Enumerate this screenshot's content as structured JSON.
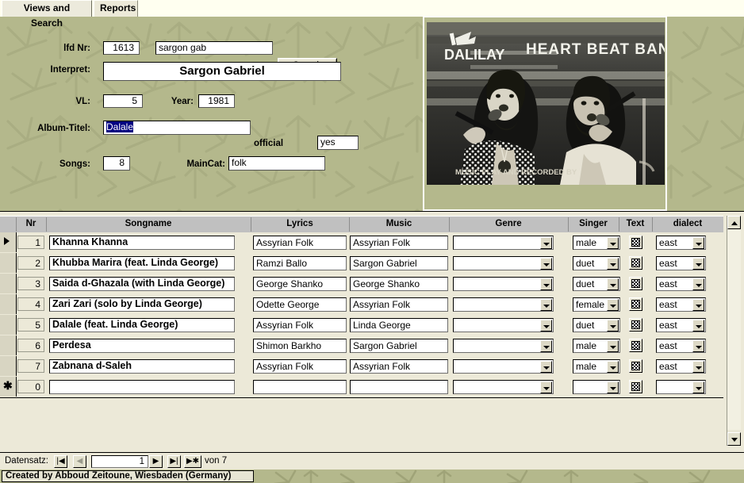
{
  "tabs": [
    {
      "label": "Views and Search",
      "active": true
    },
    {
      "label": "Reports",
      "active": false
    }
  ],
  "form": {
    "lfd_nr_label": "lfd Nr:",
    "lfd_nr_value": "1613",
    "search_term_value": "sargon gab",
    "search_button": "Search",
    "interpret_label": "Interpret:",
    "interpret_value": "Sargon Gabriel",
    "vl_label": "VL:",
    "vl_value": "5",
    "year_label": "Year:",
    "year_value": "1981",
    "album_label": "Album-Titel:",
    "album_value": "Dalale",
    "official_label": "official",
    "official_value": "yes",
    "songs_label": "Songs:",
    "songs_value": "8",
    "maincat_label": "MainCat:",
    "maincat_value": "folk"
  },
  "photo": {
    "label_left": "DALILAY",
    "label_right": "HEART BEAT BAND",
    "caption": "MUSIC PLAY AND RECORDED BY"
  },
  "table": {
    "columns": [
      "Nr",
      "Songname",
      "Lyrics",
      "Music",
      "Genre",
      "Singer",
      "Text",
      "dialect"
    ],
    "rows": [
      {
        "marker": "current",
        "nr": "1",
        "songname": "Khanna Khanna",
        "lyrics": "Assyrian Folk",
        "music": "Assyrian Folk",
        "genre": "",
        "singer": "male",
        "text": "",
        "dialect": "east"
      },
      {
        "marker": "",
        "nr": "2",
        "songname": "Khubba Marira  (feat. Linda George)",
        "lyrics": "Ramzi Ballo",
        "music": "Sargon Gabriel",
        "genre": "",
        "singer": "duet",
        "text": "",
        "dialect": "east"
      },
      {
        "marker": "",
        "nr": "3",
        "songname": "Saida d-Ghazala  (with Linda George)",
        "lyrics": "George Shanko",
        "music": "George Shanko",
        "genre": "",
        "singer": "duet",
        "text": "",
        "dialect": "east"
      },
      {
        "marker": "",
        "nr": "4",
        "songname": "Zari Zari (solo by Linda George)",
        "lyrics": "Odette George",
        "music": "Assyrian Folk",
        "genre": "",
        "singer": "female",
        "text": "",
        "dialect": "east"
      },
      {
        "marker": "",
        "nr": "5",
        "songname": "Dalale  (feat.  Linda George)",
        "lyrics": "Assyrian Folk",
        "music": "Linda George",
        "genre": "",
        "singer": "duet",
        "text": "",
        "dialect": "east"
      },
      {
        "marker": "",
        "nr": "6",
        "songname": "Perdesa",
        "lyrics": "Shimon Barkho",
        "music": "Sargon Gabriel",
        "genre": "",
        "singer": "male",
        "text": "",
        "dialect": "east"
      },
      {
        "marker": "",
        "nr": "7",
        "songname": "Zabnana d-Saleh",
        "lyrics": "Assyrian Folk",
        "music": "Assyrian Folk",
        "genre": "",
        "singer": "male",
        "text": "",
        "dialect": "east"
      },
      {
        "marker": "new",
        "nr": "0",
        "songname": "",
        "lyrics": "",
        "music": "",
        "genre": "",
        "singer": "",
        "text": "",
        "dialect": ""
      }
    ]
  },
  "nav": {
    "label": "Datensatz:",
    "first": "|◀",
    "prev": "◀",
    "current": "1",
    "next": "▶",
    "last": "▶|",
    "new": "▶✱",
    "of_label": "von",
    "total": "7"
  },
  "status": {
    "text": "Created by Abboud Zeitoune, Wiesbaden (Germany)"
  },
  "colors": {
    "form_background": "#b4b88c",
    "sheet_background": "#ece9d8",
    "header_gray": "#c0c0c0",
    "selection_blue": "#000080",
    "window_cream": "#fffff0"
  }
}
